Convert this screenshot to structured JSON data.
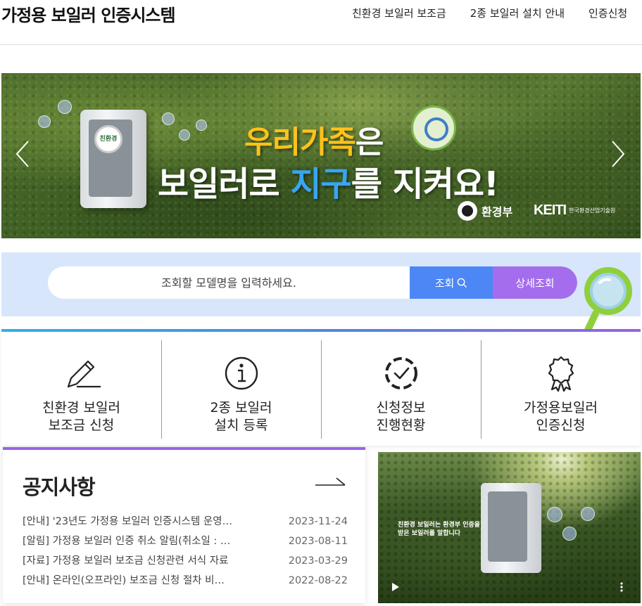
{
  "header": {
    "logo": "가정용 보일러 인증시스템",
    "nav": [
      "친환경 보일러 보조금",
      "2종 보일러 설치 안내",
      "인증신청"
    ]
  },
  "banner": {
    "slogan_part1": "우리가족",
    "slogan_part2": "은",
    "slogan_part3": "보일러로 ",
    "slogan_part4": "지구",
    "slogan_part5": "를 지켜요!",
    "boiler_label": "친환경",
    "org1": "환경부",
    "org2": "KEITI",
    "org2_sub": "한국환경산업기술원",
    "colors": {
      "yellow": "#ffc21a",
      "blue": "#39a5f2"
    }
  },
  "search": {
    "placeholder": "조회할 모델명을 입력하세요.",
    "search_label": "조회",
    "detail_label": "상세조회",
    "colors": {
      "search": "#4d87f5",
      "detail": "#a46ded",
      "bg": "#d7e6fb"
    }
  },
  "quick_menu": [
    {
      "icon": "pencil-icon",
      "label": "친환경 보일러\n보조금 신청"
    },
    {
      "icon": "info-icon",
      "label": "2종 보일러\n설치 등록"
    },
    {
      "icon": "progress-check-icon",
      "label": "신청정보\n진행현황"
    },
    {
      "icon": "award-icon",
      "label": "가정용보일러\n인증신청"
    }
  ],
  "notice": {
    "title": "공지사항",
    "items": [
      {
        "title": "[안내] '23년도 가정용 보일러 인증시스템 운영…",
        "date": "2023-11-24"
      },
      {
        "title": "[알림] 가정용 보일러 인증 취소 알림(취소일 : …",
        "date": "2023-08-11"
      },
      {
        "title": "[자료] 가정용 보일러 보조금 신청관련 서식 자료",
        "date": "2023-03-29"
      },
      {
        "title": "[안내] 온라인(오프라인) 보조금 신청 절차 비…",
        "date": "2022-08-22"
      }
    ]
  },
  "video": {
    "caption_line1": "친환경 보일러는 환경부 인증을",
    "caption_line2": "받은 보일러를 말합니다"
  }
}
